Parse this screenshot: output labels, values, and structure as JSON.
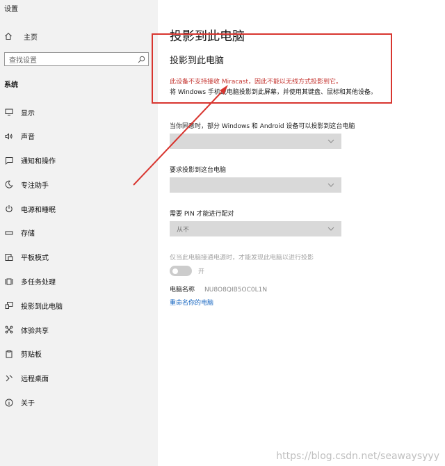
{
  "window": {
    "title": "设置"
  },
  "sidebar": {
    "home_label": "主页",
    "search_placeholder": "查找设置",
    "section_label": "系统",
    "items": [
      {
        "label": "显示",
        "icon": "monitor-icon"
      },
      {
        "label": "声音",
        "icon": "speaker-icon"
      },
      {
        "label": "通知和操作",
        "icon": "notification-icon"
      },
      {
        "label": "专注助手",
        "icon": "moon-icon"
      },
      {
        "label": "电源和睡眠",
        "icon": "power-icon"
      },
      {
        "label": "存储",
        "icon": "storage-icon"
      },
      {
        "label": "平板模式",
        "icon": "tablet-mode-icon"
      },
      {
        "label": "多任务处理",
        "icon": "multitasking-icon"
      },
      {
        "label": "投影到此电脑",
        "icon": "project-icon"
      },
      {
        "label": "体验共享",
        "icon": "share-icon"
      },
      {
        "label": "剪贴板",
        "icon": "clipboard-icon"
      },
      {
        "label": "远程桌面",
        "icon": "remote-desktop-icon"
      },
      {
        "label": "关于",
        "icon": "info-icon"
      }
    ]
  },
  "main": {
    "page_title": "投影到此电脑",
    "subtitle": "投影到此电脑",
    "warning": "此设备不支持接收 Miracast，因此不能以无线方式投影到它。",
    "description": "将 Windows 手机或电脑投影到此屏幕，并使用其键盘、鼠标和其他设备。",
    "setting1_label": "当你同意时，部分 Windows 和 Android 设备可以投影到这台电脑",
    "setting1_value": "",
    "setting2_label": "要求投影到这台电脑",
    "setting2_value": "",
    "setting3_label": "需要 PIN 才能进行配对",
    "setting3_value": "从不",
    "power_only_label": "仅当此电脑接通电源时，才能发现此电脑以进行投影",
    "toggle_state_label": "开",
    "pc_name_label": "电脑名称",
    "pc_name_value": "NU8O8QIB5OC0L1N",
    "rename_link": "重命名你的电脑"
  },
  "watermark": "https://blog.csdn.net/seawaysyyy",
  "colors": {
    "annotation": "#d8352f",
    "link": "#1565c0",
    "warning_text": "#c4342f"
  }
}
